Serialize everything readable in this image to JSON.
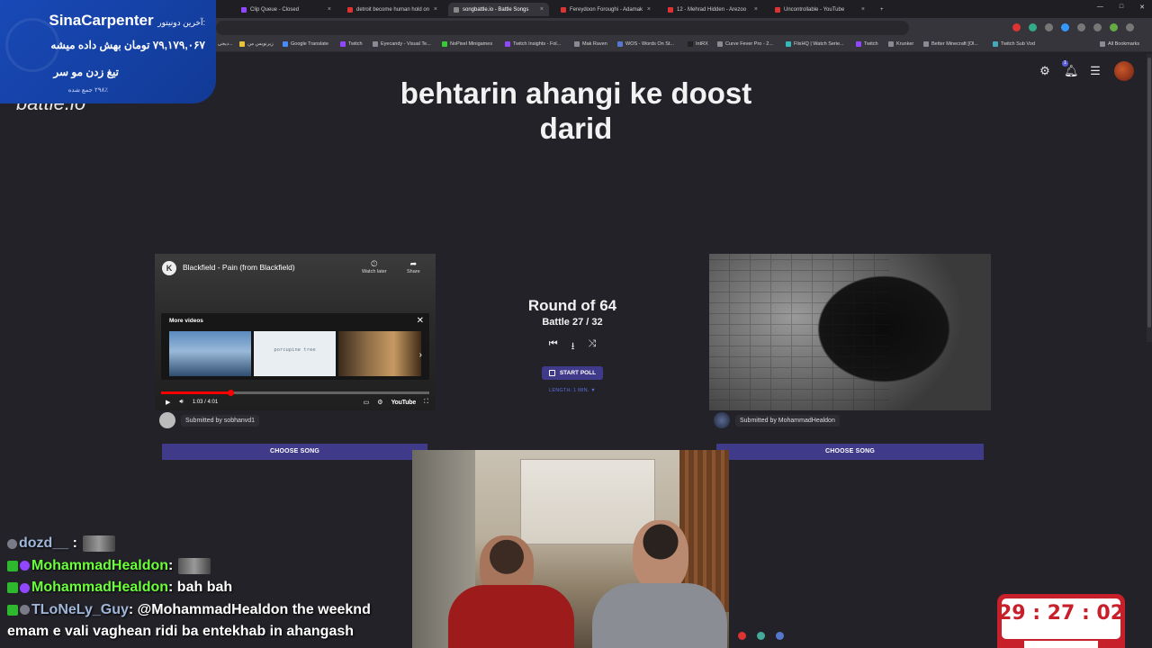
{
  "browser": {
    "tabs": [
      {
        "title": "Clip Queue - Closed",
        "active": false
      },
      {
        "title": "detroit become human hold on",
        "active": false
      },
      {
        "title": "songbattle.io - Battle Songs",
        "active": true
      },
      {
        "title": "Fereydoon Foroughi - Adamak",
        "active": false
      },
      {
        "title": "12 - Mehrad Hidden - Arezoo",
        "active": false
      },
      {
        "title": "Uncontrollable - YouTube",
        "active": false
      }
    ],
    "new_tab": "+",
    "close_glyph": "×",
    "bookmarks": [
      "دیجی م...",
      "زیرنویس من",
      "Google Translate",
      "Twitch",
      "Eyecandy - Visual Te...",
      "NoPixel Minigames",
      "Twitch Insights - Fol...",
      "Mak Raven",
      "WOS - Words On St...",
      "IntRX",
      "Curve Fever Pro - 2...",
      "FlixHQ | Watch Serie...",
      "Twitch",
      "Krunker",
      "Better Minecraft [Ol...",
      "Twitch Sub Vod"
    ],
    "all_bookmarks": "All Bookmarks"
  },
  "page": {
    "logo": "battle.io",
    "title": "behtarin ahangi ke doost darid",
    "notification_count": "1",
    "round_label": "Round of 64",
    "battle_label": "Battle 27 / 32",
    "start_poll": "START POLL",
    "length": "LENGTH: 1 MIN. ▼",
    "left": {
      "channel_initial": "K",
      "video_title": "Blackfield - Pain (from Blackfield)",
      "watch_later": "Watch later",
      "share": "Share",
      "more_videos": "More videos",
      "thumb2_text": "porcupine tree",
      "time": "1:03 / 4:01",
      "progress": 0.26,
      "youtube": "YouTube",
      "submitted_by": "Submitted by sobhanvd1",
      "choose": "CHOOSE SONG"
    },
    "right": {
      "submitted_by": "Submitted by MohammadHealdon",
      "choose": "CHOOSE SONG"
    }
  },
  "donation": {
    "label": "آخرین دونیتور:",
    "name": "SinaCarpenter",
    "amount": "۷۹,۱۷۹,۰۶۷ تومان بهش داده میشه",
    "goal": "تیغ زدن مو سر",
    "percent": "۲۹۸٪ جمع شده"
  },
  "chat": [
    {
      "user": "dozd__",
      "sep": ":",
      "message": "",
      "emote": true,
      "color": "blue"
    },
    {
      "user": "MohammadHealdon",
      "sep": ":",
      "message": "",
      "emote": true,
      "color": "green"
    },
    {
      "user": "MohammadHealdon",
      "sep": ":",
      "message": "bah bah",
      "emote": false,
      "color": "green"
    },
    {
      "user": "TLoNeLy_Guy",
      "sep": ":",
      "message": "@MohammadHealdon the weeknd",
      "emote": false,
      "color": "blue"
    },
    {
      "user": "",
      "sep": "",
      "message": "emam e vali vaghean ridi ba entekhab in ahangash",
      "emote": false,
      "color": "none"
    }
  ],
  "timer": {
    "display": "29 : 27 : 02"
  },
  "colors": {
    "accent": "#3f3a8a",
    "background": "#232228",
    "donation": "#1849b6",
    "timer": "#c7202a",
    "chat_green": "#6bff3a"
  }
}
